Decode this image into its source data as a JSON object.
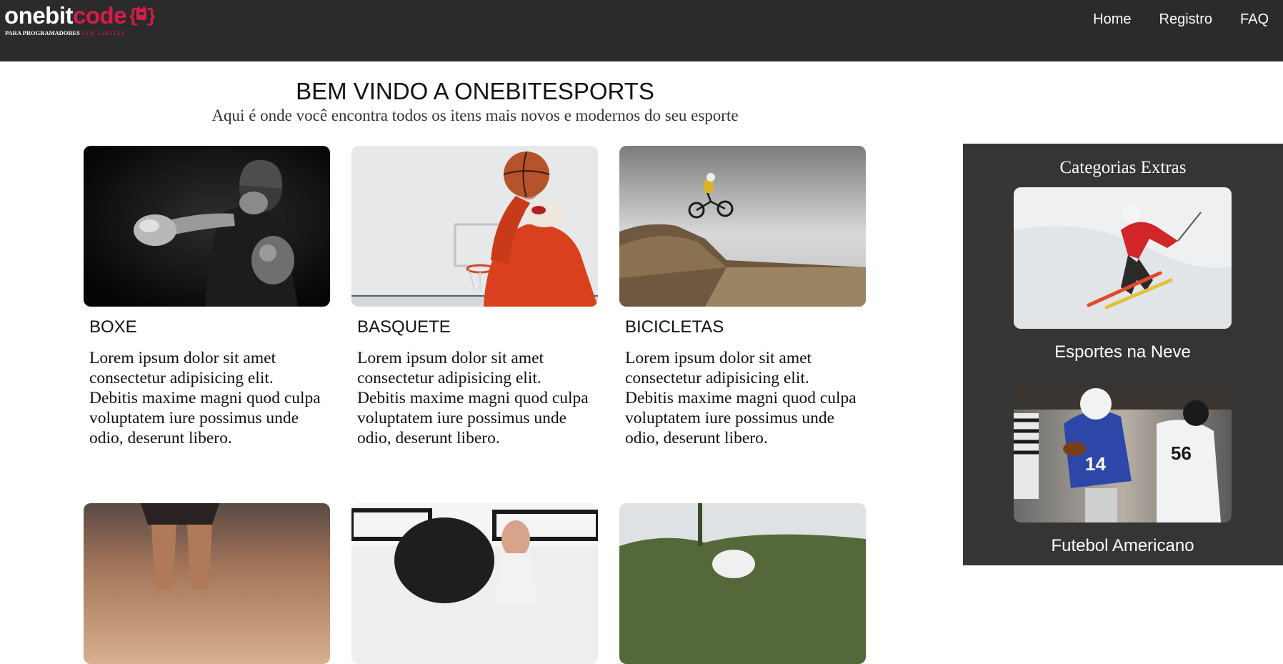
{
  "brand": {
    "name_part1": "onebit",
    "name_part2": "code",
    "tagline_part1": "PARA PROGRAMADORES",
    "tagline_part2": "SEM LIMITES",
    "accent_color": "#d81b4a",
    "badge_icon": "rock-hand-icon"
  },
  "nav": {
    "items": [
      {
        "label": "Home"
      },
      {
        "label": "Registro"
      },
      {
        "label": "FAQ"
      }
    ]
  },
  "hero": {
    "title": "BEM VINDO A ONEBITESPORTS",
    "subtitle": "Aqui é onde você encontra todos os itens mais novos e modernos do seu esporte"
  },
  "cards": [
    {
      "title": "BOXE",
      "text": "Lorem ipsum dolor sit amet consectetur adipisicing elit. Debitis maxime magni quod culpa voluptatem iure possimus unde odio, deserunt libero.",
      "image": "boxer-photo"
    },
    {
      "title": "BASQUETE",
      "text": "Lorem ipsum dolor sit amet consectetur adipisicing elit. Debitis maxime magni quod culpa voluptatem iure possimus unde odio, deserunt libero.",
      "image": "basketball-photo"
    },
    {
      "title": "BICICLETAS",
      "text": "Lorem ipsum dolor sit amet consectetur adipisicing elit. Debitis maxime magni quod culpa voluptatem iure possimus unde odio, deserunt libero.",
      "image": "bike-jump-photo"
    },
    {
      "image": "runner-photo"
    },
    {
      "image": "gym-tire-photo"
    },
    {
      "image": "outdoor-photo"
    }
  ],
  "sidebar": {
    "title": "Categorias Extras",
    "items": [
      {
        "label": "Esportes na Neve",
        "image": "skier-photo"
      },
      {
        "label": "Futebol Americano",
        "image": "football-photo"
      }
    ],
    "background_color": "#353535"
  }
}
